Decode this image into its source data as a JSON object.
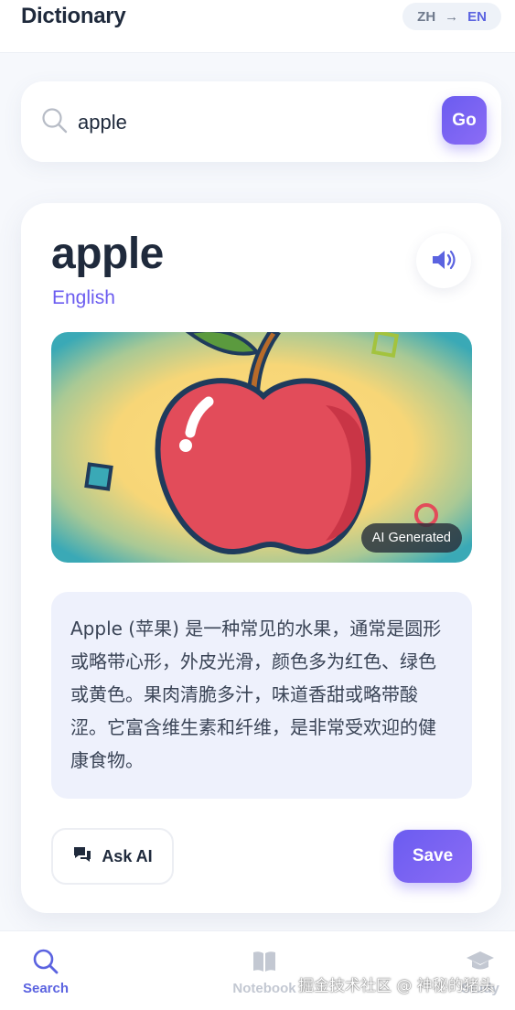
{
  "header": {
    "title": "Dictionary",
    "lang_from": "ZH",
    "lang_arrow": "→",
    "lang_to": "EN"
  },
  "search": {
    "value": "apple",
    "placeholder": "",
    "go_label": "Go"
  },
  "result": {
    "word": "apple",
    "language": "English",
    "image_badge": "AI Generated",
    "definition": "Apple (苹果) 是一种常见的水果，通常是圆形或略带心形，外皮光滑，颜色多为红色、绿色或黄色。果肉清脆多汁，味道香甜或略带酸涩。它富含维生素和纤维，是非常受欢迎的健康食物。",
    "ask_ai_label": "Ask AI",
    "save_label": "Save"
  },
  "nav": {
    "items": [
      {
        "label": "Search",
        "icon": "search-icon",
        "active": true
      },
      {
        "label": "Notebook",
        "icon": "book-icon",
        "active": false
      },
      {
        "label": "Study",
        "icon": "graduation-cap-icon",
        "active": false
      }
    ]
  },
  "watermark": "掘金技术社区 @ 神秘的猪头",
  "colors": {
    "accent": "#6b5cf0",
    "text": "#1f2a3c",
    "definition_bg": "#eef1fc"
  }
}
